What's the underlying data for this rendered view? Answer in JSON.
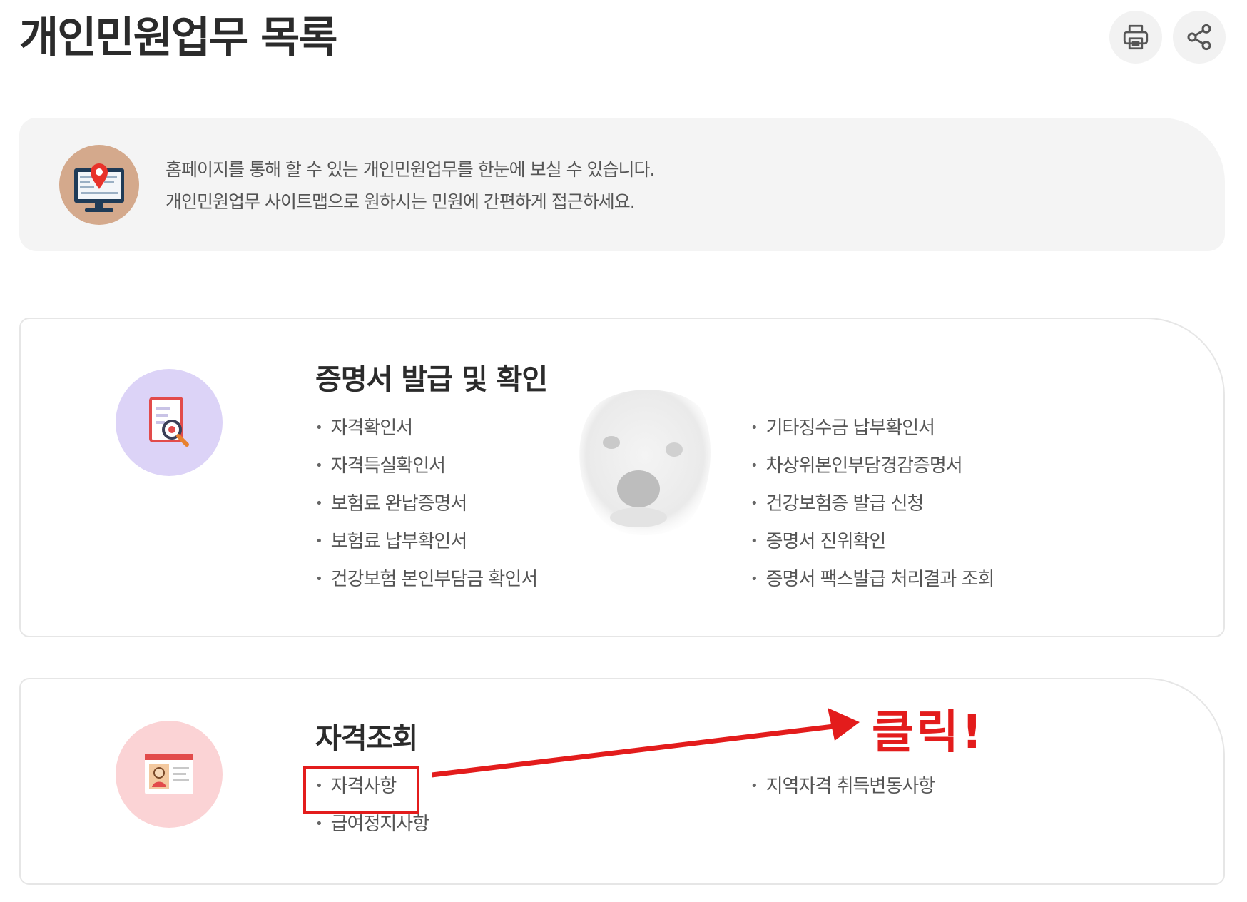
{
  "page": {
    "title": "개인민원업무 목록"
  },
  "toolbar": {
    "print_icon": "printer-icon",
    "share_icon": "share-icon"
  },
  "intro": {
    "icon": "monitor-location-pin-icon",
    "line1": "홈페이지를 통해 할 수 있는 개인민원업무를 한눈에 보실 수 있습니다.",
    "line2": "개인민원업무 사이트맵으로 원하시는 민원에 간편하게 접근하세요."
  },
  "sections": [
    {
      "title": "증명서 발급 및 확인",
      "icon": "document-search-icon",
      "icon_bg": "#dcd3f7",
      "col1": [
        "자격확인서",
        "자격득실확인서",
        "보험료 완납증명서",
        "보험료 납부확인서",
        "건강보험 본인부담금 확인서"
      ],
      "col2": [
        "기타징수금 납부확인서",
        "차상위본인부담경감증명서",
        "건강보험증 발급 신청",
        "증명서 진위확인",
        "증명서 팩스발급 처리결과 조회"
      ]
    },
    {
      "title": "자격조회",
      "icon": "id-card-icon",
      "icon_bg": "#fbd3d5",
      "col1": [
        "자격사항",
        "급여정지사항"
      ],
      "col2": [
        "지역자격 취득변동사항"
      ]
    }
  ],
  "annotation": {
    "click_label": "클릭!",
    "color": "#e31c1c"
  },
  "overlay_image": "dog-face-watermark"
}
